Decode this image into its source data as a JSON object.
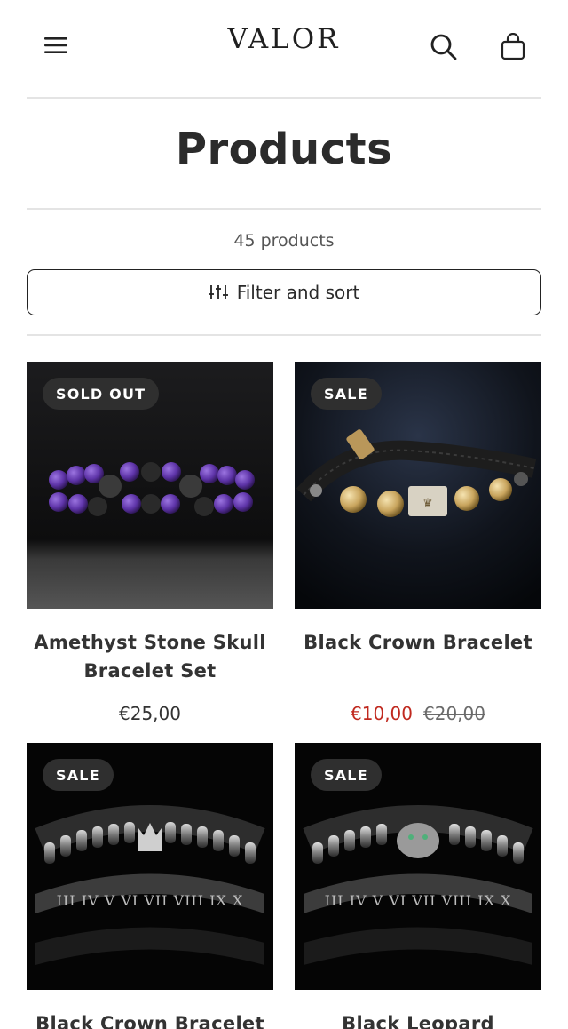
{
  "header": {
    "logo": "VALOR",
    "menu_icon": "hamburger-menu-icon",
    "search_icon": "search-icon",
    "cart_icon": "shopping-bag-icon"
  },
  "page": {
    "title": "Products",
    "product_count": "45 products",
    "filter_label": "Filter and sort"
  },
  "products": [
    {
      "badge": "SOLD OUT",
      "title": "Amethyst Stone Skull Bracelet Set",
      "price": "€25,00",
      "old_price": ""
    },
    {
      "badge": "SALE",
      "title": "Black Crown Bracelet",
      "price": "€10,00",
      "old_price": "€20,00"
    },
    {
      "badge": "SALE",
      "title": "Black Crown Bracelet",
      "price": "",
      "old_price": ""
    },
    {
      "badge": "SALE",
      "title": "Black Leopard Bracelet",
      "price": "",
      "old_price": ""
    }
  ],
  "colors": {
    "sale_price": "#c0291f",
    "badge_bg": "#2f2f2f",
    "amethyst": "#6a3fb0"
  }
}
